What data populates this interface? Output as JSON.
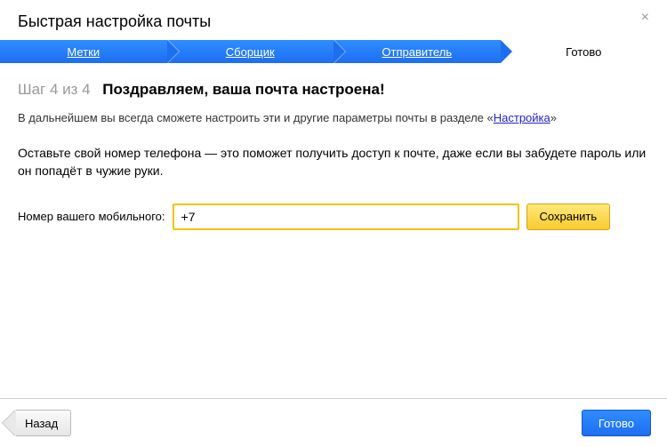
{
  "header": {
    "title": "Быстрая настройка почты",
    "close": "×"
  },
  "steps": {
    "s1": "Метки",
    "s2": "Сборщик",
    "s3": "Отправитель",
    "s4": "Готово"
  },
  "main": {
    "step_num": "Шаг 4 из 4",
    "step_title": "Поздравляем, ваша почта настроена!",
    "desc_prefix": "В дальнейшем вы всегда сможете настроить эти и другие параметры почты в разделе «",
    "desc_link": "Настройка",
    "desc_suffix": "»",
    "phone_desc": "Оставьте свой номер телефона — это поможет получить доступ к почте, даже если вы забудете пароль или он попадёт в чужие руки.",
    "phone_label": "Номер вашего мобильного:",
    "phone_value": "+7",
    "save": "Сохранить"
  },
  "footer": {
    "back": "Назад",
    "done": "Готово"
  }
}
